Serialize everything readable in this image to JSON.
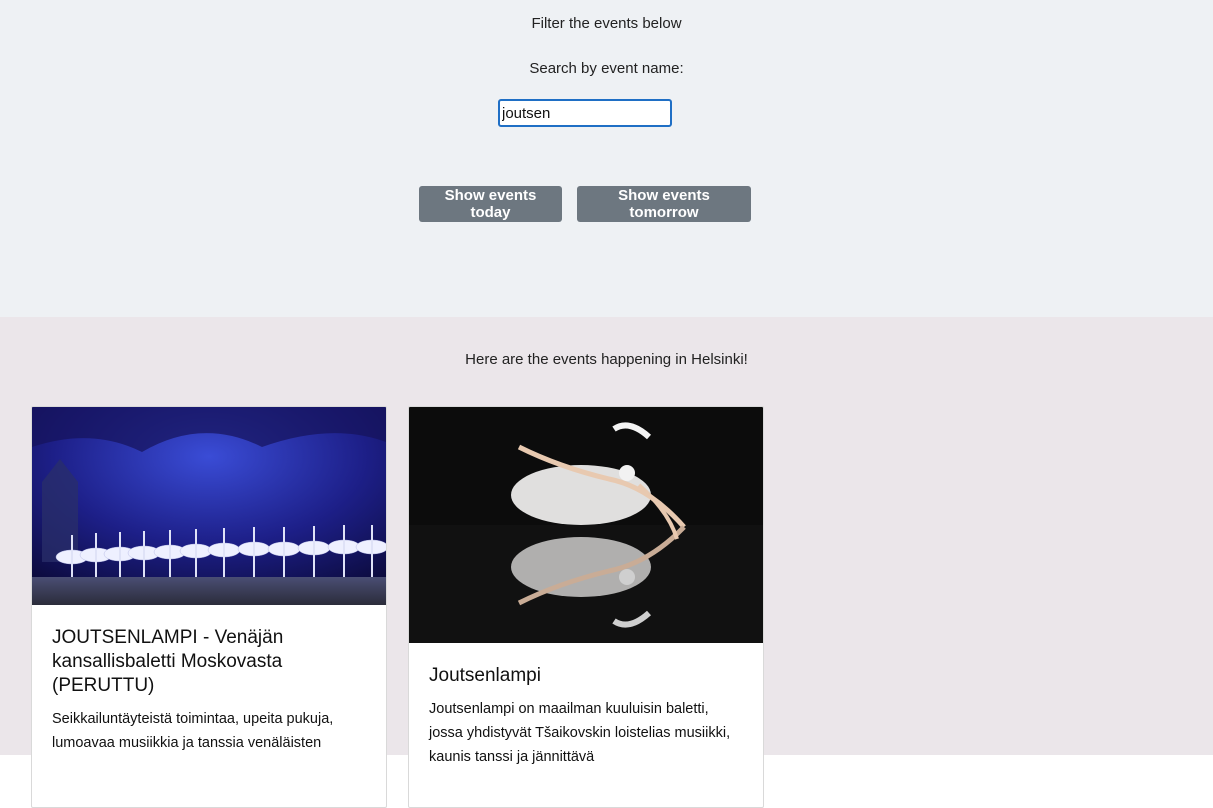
{
  "filter": {
    "title": "Filter the events below",
    "search_label": "Search by event name:",
    "search_value": "joutsen"
  },
  "buttons": {
    "today": "Show events today",
    "tomorrow": "Show events tomorrow"
  },
  "events_section": {
    "heading": "Here are the events happening in Helsinki!",
    "cards": [
      {
        "title": "JOUTSENLAMPI - Venäjän kansallisbaletti Moskovasta (PERUTTU)",
        "description": "Seikkailuntäyteistä toimintaa, upeita pukuja, lumoavaa musiikkia ja tanssia venäläisten",
        "image": "ballet-stage-swans-photo"
      },
      {
        "title": "Joutsenlampi",
        "description": "Joutsenlampi on maailman kuuluisin baletti, jossa yhdistyvät Tšaikovskin loistelias musiikki, kaunis tanssi ja jännittävä",
        "image": "ballerina-reflection-photo"
      }
    ]
  },
  "colors": {
    "top_background": "#eef1f4",
    "bottom_background": "#ebe6ea",
    "button": "#6d7780",
    "input_border": "#1f6fc5"
  }
}
